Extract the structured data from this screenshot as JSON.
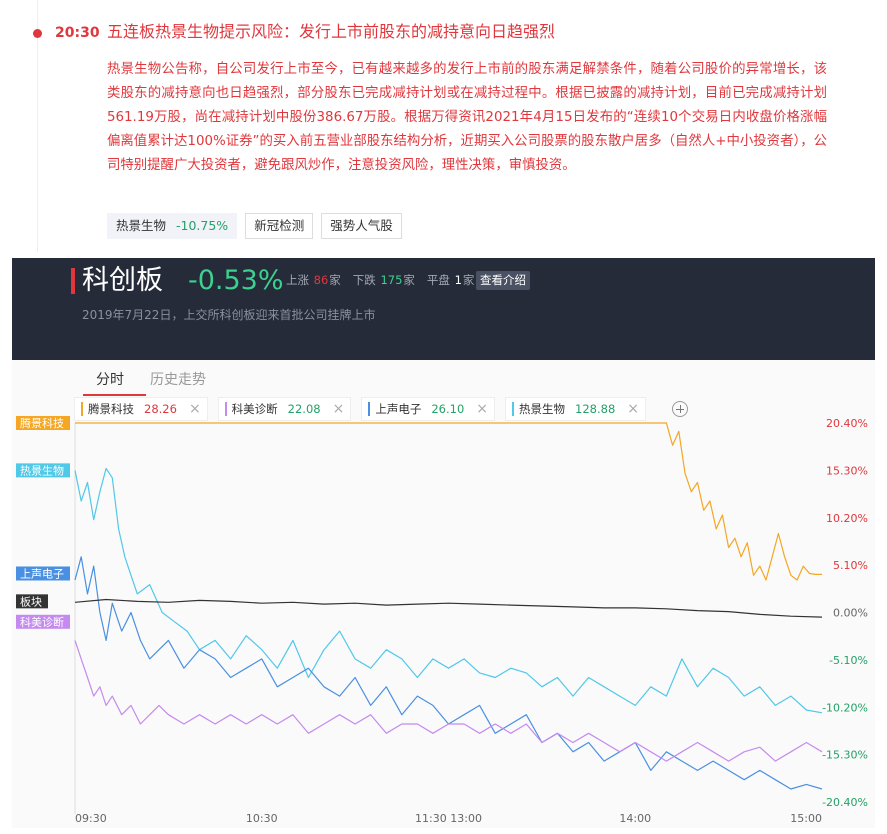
{
  "news": {
    "time": "20:30",
    "title": "五连板热景生物提示风险：发行上市前股东的减持意向日趋强烈",
    "body": "热景生物公告称，自公司发行上市至今，已有越来越多的发行上市前的股东满足解禁条件，随着公司股价的异常增长，该类股东的减持意向也日趋强烈，部分股东已完成减持计划或在减持过程中。根据已披露的减持计划，目前已完成减持计划561.19万股，尚在减持计划中股份386.67万股。根据万得资讯2021年4月15日发布的“连续10个交易日内收盘价格涨幅偏离值累计达100%证券”的买入前五营业部股东结构分析，近期买入公司股票的股东散户居多（自然人+中小投资者），公司特别提醒广大投资者，避免跟风炒作，注意投资风险，理性决策，审慎投资。",
    "stock_tag": {
      "name": "热景生物",
      "change": "-10.75%"
    },
    "tags": [
      "新冠检测",
      "强势人气股"
    ]
  },
  "board": {
    "name": "科创板",
    "change": "-0.53%",
    "up_label": "上涨",
    "up_count": "86",
    "up_unit": "家",
    "down_label": "下跌",
    "down_count": "175",
    "down_unit": "家",
    "flat_label": "平盘",
    "flat_count": "1",
    "flat_unit": "家",
    "intro_button": "查看介绍",
    "description": "2019年7月22日，上交所科创板迎来首批公司挂牌上市"
  },
  "tabs": [
    "分时",
    "历史走势"
  ],
  "active_tab": 0,
  "legend": [
    {
      "name": "腾景科技",
      "value": "28.26",
      "color": "#f5a623",
      "value_color": "#e0373c"
    },
    {
      "name": "科美诊断",
      "value": "22.08",
      "color": "#c58af0",
      "value_color": "#23a167"
    },
    {
      "name": "上声电子",
      "value": "26.10",
      "color": "#4a90e2",
      "value_color": "#23a167"
    },
    {
      "name": "热景生物",
      "value": "128.88",
      "color": "#50c8e8",
      "value_color": "#23a167"
    }
  ],
  "legend_close": "×",
  "colors": {
    "up": "#e0373c",
    "down": "#23a167",
    "board_line": "#333333",
    "header_bg": "#252b38"
  },
  "chart_data": {
    "type": "line",
    "x_ticks": [
      "09:30",
      "10:30",
      "11:30 13:00",
      "14:00",
      "15:00"
    ],
    "y_ticks": [
      "20.40%",
      "15.30%",
      "10.20%",
      "5.10%",
      "0.00%",
      "-5.10%",
      "-10.20%",
      "-15.30%",
      "-20.40%"
    ],
    "ylim": [
      -20.4,
      20.4
    ],
    "x_range": [
      0,
      240
    ],
    "series_tags": [
      "腾景科技",
      "热景生物",
      "上声电子",
      "板块",
      "科美诊断"
    ],
    "series": [
      {
        "name": "腾景科技",
        "color": "#f5a623",
        "label_bg": "#f5a623",
        "x": [
          0,
          190,
          192,
          194,
          196,
          198,
          200,
          202,
          204,
          206,
          208,
          210,
          212,
          214,
          216,
          218,
          220,
          222,
          224,
          226,
          228,
          230,
          232,
          234,
          236,
          238,
          240
        ],
        "y": [
          20.4,
          20.4,
          18,
          19.5,
          15,
          13,
          14,
          11,
          12,
          9,
          10.5,
          7,
          8,
          6,
          7.5,
          4,
          5,
          3.5,
          6,
          8.5,
          6,
          4,
          3.5,
          5,
          4.2,
          4.1,
          4.1
        ]
      },
      {
        "name": "热景生物",
        "color": "#50c8e8",
        "label_bg": "#50c8e8",
        "x": [
          0,
          2,
          4,
          6,
          8,
          10,
          12,
          14,
          16,
          18,
          20,
          24,
          28,
          32,
          36,
          40,
          45,
          50,
          55,
          60,
          65,
          70,
          75,
          80,
          85,
          90,
          95,
          100,
          105,
          110,
          115,
          120,
          125,
          130,
          135,
          140,
          145,
          150,
          155,
          160,
          165,
          170,
          175,
          180,
          185,
          190,
          195,
          200,
          205,
          210,
          215,
          220,
          225,
          230,
          235,
          240
        ],
        "y": [
          15.3,
          12,
          14,
          10,
          13,
          15.5,
          14.5,
          9,
          6,
          4,
          2,
          3,
          0,
          -1,
          -2,
          -4,
          -3,
          -5,
          -2.5,
          -4,
          -6,
          -3,
          -7,
          -4,
          -2,
          -5,
          -6,
          -4,
          -5,
          -7,
          -5,
          -6,
          -5,
          -6.5,
          -7,
          -6,
          -6.5,
          -8,
          -7,
          -9,
          -7,
          -8,
          -9,
          -10,
          -8,
          -9,
          -5,
          -8,
          -6,
          -7,
          -9,
          -8,
          -10,
          -9,
          -10.5,
          -10.8
        ]
      },
      {
        "name": "上声电子",
        "color": "#4a90e2",
        "label_bg": "#4a90e2",
        "x": [
          0,
          2,
          4,
          6,
          8,
          10,
          12,
          15,
          18,
          21,
          24,
          27,
          30,
          35,
          40,
          45,
          50,
          55,
          60,
          65,
          70,
          75,
          80,
          85,
          90,
          95,
          100,
          105,
          110,
          115,
          120,
          125,
          130,
          135,
          140,
          145,
          150,
          155,
          160,
          165,
          170,
          175,
          180,
          185,
          190,
          195,
          200,
          205,
          210,
          215,
          220,
          225,
          230,
          235,
          240
        ],
        "y": [
          3.5,
          6,
          2,
          5,
          0,
          -3,
          1,
          -2,
          0,
          -3,
          -5,
          -4,
          -3,
          -6,
          -4,
          -5,
          -7,
          -6,
          -5,
          -8,
          -7,
          -6,
          -8,
          -9,
          -7,
          -10,
          -8,
          -11,
          -9,
          -10,
          -12,
          -11,
          -10,
          -13,
          -12,
          -11,
          -14,
          -13,
          -15,
          -14,
          -16,
          -15,
          -14,
          -17,
          -15,
          -16,
          -17,
          -16,
          -17,
          -18,
          -17,
          -18,
          -19,
          -18.5,
          -19
        ]
      },
      {
        "name": "板块",
        "color": "#333333",
        "label_bg": "#333333",
        "x": [
          0,
          10,
          20,
          30,
          40,
          50,
          60,
          70,
          80,
          90,
          100,
          110,
          120,
          130,
          140,
          150,
          160,
          170,
          180,
          190,
          200,
          210,
          220,
          230,
          240
        ],
        "y": [
          1.1,
          1.4,
          1.2,
          1.1,
          1.3,
          1.2,
          1.0,
          1.1,
          0.9,
          1.0,
          0.8,
          0.9,
          1.0,
          0.9,
          0.8,
          0.7,
          0.6,
          0.5,
          0.5,
          0.4,
          0.2,
          0.1,
          -0.2,
          -0.4,
          -0.5
        ]
      },
      {
        "name": "科美诊断",
        "color": "#c58af0",
        "label_bg": "#c58af0",
        "x": [
          0,
          2,
          4,
          6,
          8,
          10,
          12,
          15,
          18,
          21,
          24,
          27,
          30,
          35,
          40,
          45,
          50,
          55,
          60,
          65,
          70,
          75,
          80,
          85,
          90,
          95,
          100,
          105,
          110,
          115,
          120,
          125,
          130,
          135,
          140,
          145,
          150,
          155,
          160,
          165,
          170,
          175,
          180,
          185,
          190,
          195,
          200,
          205,
          210,
          215,
          220,
          225,
          230,
          235,
          240
        ],
        "y": [
          -3,
          -5,
          -7,
          -9,
          -8,
          -10,
          -9,
          -11,
          -10,
          -12,
          -11,
          -10,
          -11,
          -12,
          -11,
          -12,
          -11,
          -12,
          -11,
          -12,
          -11,
          -13,
          -12,
          -11,
          -12,
          -11,
          -13,
          -12,
          -12,
          -13,
          -12,
          -12,
          -13,
          -12,
          -13,
          -12,
          -14,
          -13,
          -14,
          -13,
          -14,
          -15,
          -14,
          -15,
          -16,
          -15,
          -14,
          -15,
          -16,
          -15,
          -14.5,
          -16,
          -15,
          -14,
          -15
        ]
      }
    ]
  }
}
